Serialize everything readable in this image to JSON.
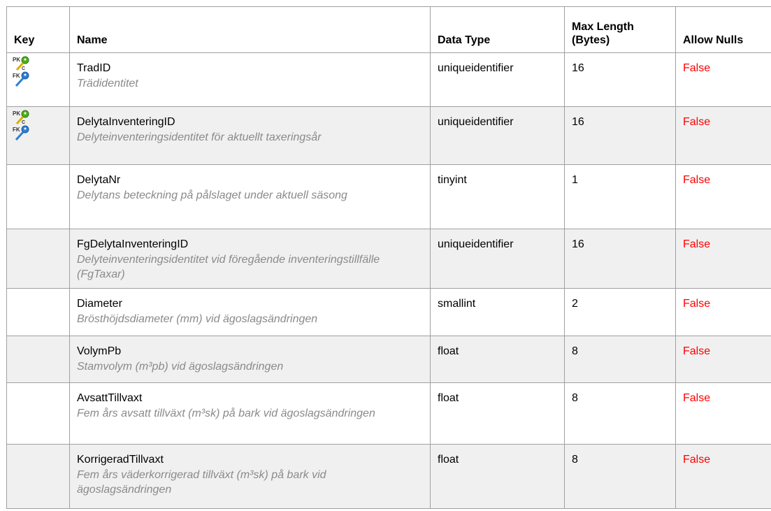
{
  "headers": {
    "key": "Key",
    "name": "Name",
    "data_type": "Data Type",
    "max_length_1": "Max Length",
    "max_length_2": "(Bytes)",
    "allow_nulls": "Allow Nulls"
  },
  "rows": [
    {
      "has_key": true,
      "key_labels": {
        "pk": "PK",
        "c": "C",
        "fk": "FK"
      },
      "name": "TradID",
      "description": "Trädidentitet",
      "data_type": "uniqueidentifier",
      "max_length": "16",
      "allow_nulls": "False"
    },
    {
      "has_key": true,
      "key_labels": {
        "pk": "PK",
        "c": "C",
        "fk": "FK"
      },
      "name": "DelytaInventeringID",
      "description": "Delyteinventeringsidentitet för aktuellt taxeringsår",
      "data_type": "uniqueidentifier",
      "max_length": "16",
      "allow_nulls": "False"
    },
    {
      "has_key": false,
      "name": "DelytaNr",
      "description": "Delytans beteckning på pålslaget under aktuell säsong",
      "data_type": "tinyint",
      "max_length": "1",
      "allow_nulls": "False"
    },
    {
      "has_key": false,
      "name": "FgDelytaInventeringID",
      "description": "Delyteinventeringsidentitet vid föregående inventeringstillfälle (FgTaxar)",
      "data_type": "uniqueidentifier",
      "max_length": "16",
      "allow_nulls": "False"
    },
    {
      "has_key": false,
      "name": "Diameter",
      "description": "Brösthöjdsdiameter (mm) vid ägoslagsändringen",
      "data_type": "smallint",
      "max_length": "2",
      "allow_nulls": "False"
    },
    {
      "has_key": false,
      "name": "VolymPb",
      "description": "Stamvolym (m³pb) vid ägoslagsändringen",
      "data_type": "float",
      "max_length": "8",
      "allow_nulls": "False"
    },
    {
      "has_key": false,
      "name": "AvsattTillvaxt",
      "description": "Fem års avsatt tillväxt (m³sk) på bark vid ägoslagsändringen",
      "data_type": "float",
      "max_length": "8",
      "allow_nulls": "False"
    },
    {
      "has_key": false,
      "name": "KorrigeradTillvaxt",
      "description": "Fem års väderkorrigerad tillväxt (m³sk) på bark vid ägoslagsändringen",
      "data_type": "float",
      "max_length": "8",
      "allow_nulls": "False"
    }
  ],
  "colors": {
    "border": "#a0a0a0",
    "shade": "#f0f0f0",
    "description": "#8a8a8a",
    "false_value": "#ff0000",
    "pk_key": "#4caf1f",
    "fk_key": "#2f7fd0"
  },
  "icons": {
    "pk_key": "green-key-icon",
    "fk_key": "blue-key-icon"
  }
}
